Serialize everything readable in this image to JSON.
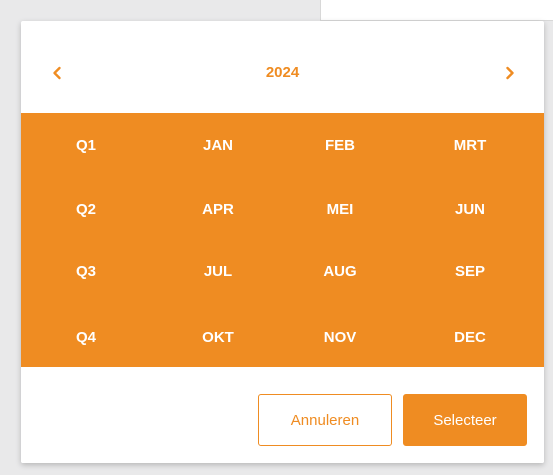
{
  "header": {
    "year": "2024",
    "prev_icon": "chevron-left-icon",
    "next_icon": "chevron-right-icon"
  },
  "grid": {
    "rows": [
      [
        "Q1",
        "JAN",
        "FEB",
        "MRT"
      ],
      [
        "Q2",
        "APR",
        "MEI",
        "JUN"
      ],
      [
        "Q3",
        "JUL",
        "AUG",
        "SEP"
      ],
      [
        "Q4",
        "OKT",
        "NOV",
        "DEC"
      ]
    ]
  },
  "footer": {
    "cancel_label": "Annuleren",
    "select_label": "Selecteer"
  },
  "colors": {
    "accent": "#ef8c22",
    "text_on_accent": "#ffffff",
    "background": "#e9e9ea"
  }
}
